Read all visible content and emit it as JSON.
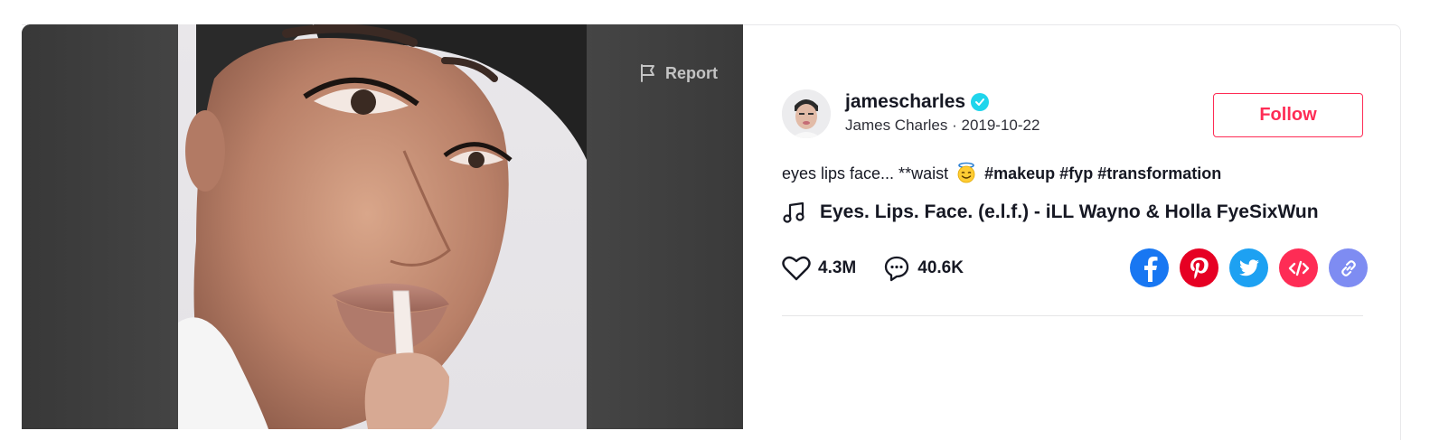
{
  "video": {
    "report_label": "Report"
  },
  "author": {
    "username": "jamescharles",
    "display_name": "James Charles",
    "date": "2019-10-22",
    "separator": " · ",
    "follow_label": "Follow"
  },
  "caption": {
    "text": "eyes lips face... **waist",
    "emoji": "smiling-face-with-halo",
    "hashtags": [
      "#makeup",
      "#fyp",
      "#transformation"
    ]
  },
  "music": {
    "icon": "music-note-icon",
    "title": "Eyes. Lips. Face. (e.l.f.) - iLL Wayno & Holla FyeSixWun"
  },
  "stats": {
    "likes": "4.3M",
    "comments": "40.6K"
  },
  "share": {
    "buttons": [
      {
        "name": "facebook",
        "color": "#1877f2"
      },
      {
        "name": "pinterest",
        "color": "#e60023"
      },
      {
        "name": "twitter",
        "color": "#1da1f2"
      },
      {
        "name": "embed",
        "color": "#fe2c55"
      },
      {
        "name": "copy-link",
        "color": "#7e8cf2"
      }
    ]
  },
  "colors": {
    "accent": "#fe2c55",
    "verified": "#20d5ec",
    "text": "#161823"
  }
}
